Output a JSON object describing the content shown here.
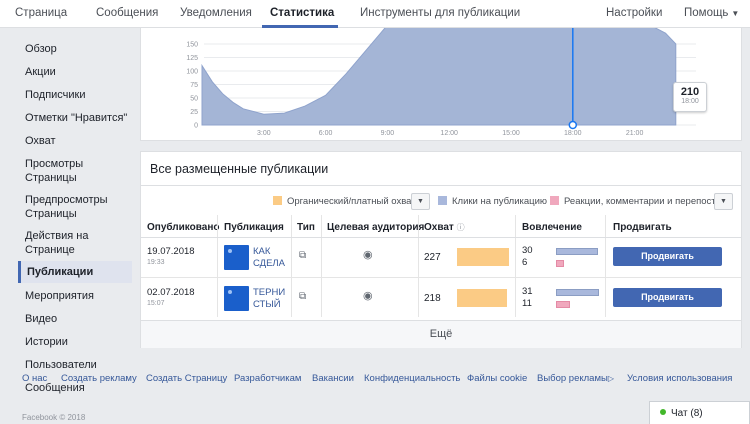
{
  "tabs": [
    {
      "label": "Страница"
    },
    {
      "label": "Сообщения"
    },
    {
      "label": "Уведомления"
    },
    {
      "label": "Статистика"
    },
    {
      "label": "Инструменты для публикации"
    },
    {
      "label": "Настройки"
    },
    {
      "label": "Помощь"
    }
  ],
  "sidebar": {
    "items": [
      {
        "label": "Обзор"
      },
      {
        "label": "Акции"
      },
      {
        "label": "Подписчики"
      },
      {
        "label": "Отметки \"Нравится\""
      },
      {
        "label": "Охват"
      },
      {
        "label": "Просмотры Страницы"
      },
      {
        "label": "Предпросмотры Страницы"
      },
      {
        "label": "Действия на Странице"
      },
      {
        "label": "Публикации"
      },
      {
        "label": "Мероприятия"
      },
      {
        "label": "Видео"
      },
      {
        "label": "Истории"
      },
      {
        "label": "Пользователи"
      },
      {
        "label": "Сообщения"
      }
    ]
  },
  "chart_data": {
    "type": "area",
    "x_ticks": [
      "3:00",
      "6:00",
      "9:00",
      "12:00",
      "15:00",
      "18:00",
      "21:00"
    ],
    "y_ticks": [
      0,
      25,
      50,
      75,
      100,
      125,
      150
    ],
    "ylim": [
      0,
      150
    ],
    "x_hours": [
      0,
      0.5,
      1,
      1.5,
      2,
      3,
      4,
      5,
      5.5,
      6,
      7,
      8,
      9,
      10,
      12,
      15,
      18,
      20,
      21,
      21.5,
      22,
      22.5,
      23
    ],
    "values": [
      110,
      80,
      58,
      42,
      30,
      20,
      22,
      35,
      45,
      55,
      95,
      140,
      185,
      210,
      210,
      210,
      210,
      210,
      200,
      190,
      180,
      170,
      150
    ],
    "highlight": {
      "hour": 18,
      "value": "210",
      "time": "18:00"
    },
    "fill": "#a4b5d6",
    "line": "#8fa3cc",
    "marker": "#1877f2"
  },
  "posts": {
    "title": "Все размещенные публикации",
    "legend": [
      {
        "label": "Органический/платный охват",
        "color": "#fbcb85"
      },
      {
        "label": "Клики на публикацию",
        "color": "#a9b8dc"
      },
      {
        "label": "Реакции, комментарии и перепосты",
        "color": "#f0a8bd"
      }
    ],
    "columns": [
      "Опубликовано",
      "Публикация",
      "Тип",
      "Целевая аудитория",
      "Охват",
      "Вовлечение",
      "Продвигать"
    ],
    "rows": [
      {
        "date": "19.07.2018",
        "time": "19:33",
        "text": "КАК СДЕЛА",
        "reach": "227",
        "reach_pct": 100,
        "clicks": "30",
        "reactions": "6",
        "boost": "Продвигать публикацию"
      },
      {
        "date": "02.07.2018",
        "time": "15:07",
        "text": "ТЕРНИ СТЫЙ",
        "reach": "218",
        "reach_pct": 96,
        "clicks": "31",
        "reactions": "11",
        "boost": "Продвигать публикацию"
      }
    ],
    "more": "Ещё"
  },
  "footer": {
    "links": [
      "О нас",
      "Создать рекламу",
      "Создать Страницу",
      "Разработчикам",
      "Вакансии",
      "Конфиденциальность",
      "Файлы cookie",
      "Выбор рекламы",
      "Условия использования"
    ],
    "copyright": "Facebook © 2018"
  },
  "chat": {
    "label": "Чат (8)"
  }
}
